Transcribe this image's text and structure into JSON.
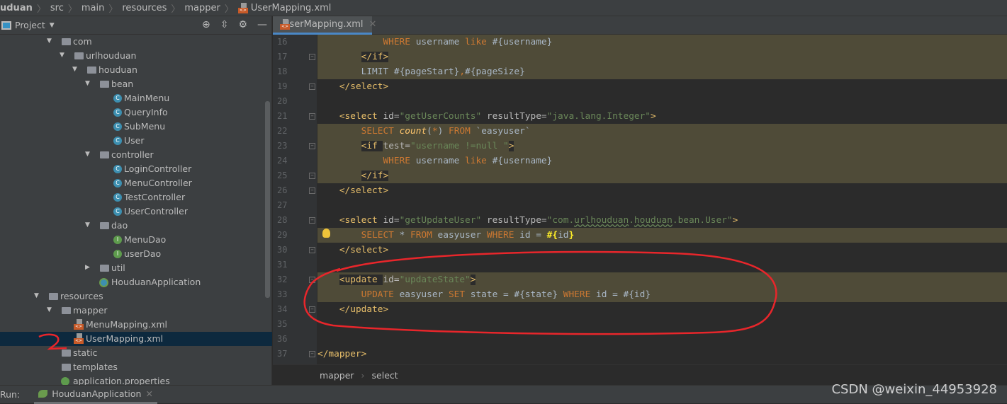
{
  "breadcrumb": [
    "uduan",
    "src",
    "main",
    "resources",
    "mapper",
    "UserMapping.xml"
  ],
  "project": {
    "title": "Project",
    "tools": [
      "locate-icon",
      "collapse-icon",
      "gear-icon",
      "minimize-icon"
    ],
    "tree": [
      {
        "label": "com",
        "depth": 1,
        "kind": "folder",
        "open": true
      },
      {
        "label": "urlhouduan",
        "depth": 2,
        "kind": "folder",
        "open": true
      },
      {
        "label": "houduan",
        "depth": 3,
        "kind": "folder",
        "open": true
      },
      {
        "label": "bean",
        "depth": 4,
        "kind": "folder",
        "open": true
      },
      {
        "label": "MainMenu",
        "depth": 5,
        "kind": "class"
      },
      {
        "label": "QueryInfo",
        "depth": 5,
        "kind": "class"
      },
      {
        "label": "SubMenu",
        "depth": 5,
        "kind": "class"
      },
      {
        "label": "User",
        "depth": 5,
        "kind": "class"
      },
      {
        "label": "controller",
        "depth": 4,
        "kind": "folder",
        "open": true
      },
      {
        "label": "LoginController",
        "depth": 5,
        "kind": "class"
      },
      {
        "label": "MenuController",
        "depth": 5,
        "kind": "class"
      },
      {
        "label": "TestController",
        "depth": 5,
        "kind": "class"
      },
      {
        "label": "UserController",
        "depth": 5,
        "kind": "class"
      },
      {
        "label": "dao",
        "depth": 4,
        "kind": "folder",
        "open": true
      },
      {
        "label": "MenuDao",
        "depth": 5,
        "kind": "interface"
      },
      {
        "label": "userDao",
        "depth": 5,
        "kind": "interface"
      },
      {
        "label": "util",
        "depth": 4,
        "kind": "folder",
        "open": false
      },
      {
        "label": "HouduanApplication",
        "depth": 4,
        "kind": "app"
      },
      {
        "label": "resources",
        "depth": 0,
        "kind": "folder",
        "open": true
      },
      {
        "label": "mapper",
        "depth": 1,
        "kind": "folder",
        "open": true
      },
      {
        "label": "MenuMapping.xml",
        "depth": 2,
        "kind": "xml"
      },
      {
        "label": "UserMapping.xml",
        "depth": 2,
        "kind": "xml",
        "selected": true
      },
      {
        "label": "static",
        "depth": 1,
        "kind": "leaf-folder"
      },
      {
        "label": "templates",
        "depth": 1,
        "kind": "leaf-folder"
      },
      {
        "label": "application.properties",
        "depth": 1,
        "kind": "props"
      }
    ]
  },
  "editor": {
    "tab": "UserMapping.xml",
    "lines": [
      {
        "n": "16",
        "hl": true,
        "t": [
          [
            "pl",
            "        "
          ],
          [
            "kw",
            "WHERE"
          ],
          [
            "pl",
            " username "
          ],
          [
            "kw",
            "like"
          ],
          [
            "pl",
            " #{username}"
          ]
        ]
      },
      {
        "n": "17",
        "hl": true,
        "f": true,
        "t": [
          [
            "pl",
            "    "
          ],
          [
            "tag",
            "</if>"
          ]
        ]
      },
      {
        "n": "18",
        "hl": true,
        "t": [
          [
            "pl",
            "    LIMIT #{pageStart}"
          ],
          [
            "kw",
            ","
          ],
          [
            "pl",
            "#{pageSize}"
          ]
        ]
      },
      {
        "n": "19",
        "f": true,
        "t": [
          [
            "tag",
            "</select>"
          ]
        ]
      },
      {
        "n": "20",
        "t": []
      },
      {
        "n": "21",
        "f": true,
        "t": [
          [
            "tag",
            "<select "
          ],
          [
            "attr",
            "id="
          ],
          [
            "str",
            "\"getUserCounts\""
          ],
          [
            "attr",
            " resultType="
          ],
          [
            "str",
            "\"java.lang.Integer\""
          ],
          [
            "tag",
            ">"
          ]
        ]
      },
      {
        "n": "22",
        "hl": true,
        "t": [
          [
            "pl",
            "    "
          ],
          [
            "kw",
            "SELECT "
          ],
          [
            "fn",
            "count"
          ],
          [
            "pl",
            "("
          ],
          [
            "kw",
            "*"
          ],
          [
            "pl",
            ") "
          ],
          [
            "kw",
            "FROM"
          ],
          [
            "pl",
            " `easyuser`"
          ]
        ]
      },
      {
        "n": "23",
        "hl": true,
        "f": true,
        "t": [
          [
            "pl",
            "    "
          ],
          [
            "tag",
            "<if "
          ],
          [
            "attr",
            "test="
          ],
          [
            "str",
            "\"username !=null \""
          ],
          [
            "tag",
            ">"
          ]
        ]
      },
      {
        "n": "24",
        "hl": true,
        "t": [
          [
            "pl",
            "        "
          ],
          [
            "kw",
            "WHERE"
          ],
          [
            "pl",
            " username "
          ],
          [
            "kw",
            "like"
          ],
          [
            "pl",
            " #{username}"
          ]
        ]
      },
      {
        "n": "25",
        "hl": true,
        "f": true,
        "t": [
          [
            "pl",
            "    "
          ],
          [
            "tag",
            "</if>"
          ]
        ]
      },
      {
        "n": "26",
        "f": true,
        "t": [
          [
            "tag",
            "</select>"
          ]
        ]
      },
      {
        "n": "27",
        "t": []
      },
      {
        "n": "28",
        "f": true,
        "t": [
          [
            "tag",
            "<select "
          ],
          [
            "attr",
            "id="
          ],
          [
            "str",
            "\"getUpdateUser\""
          ],
          [
            "attr",
            " resultType="
          ],
          [
            "str",
            "\"com."
          ],
          [
            "ul",
            "urlhouduan"
          ],
          [
            "str",
            "."
          ],
          [
            "ul",
            "houduan"
          ],
          [
            "str",
            ".bean.User\""
          ],
          [
            "tag",
            ">"
          ]
        ]
      },
      {
        "n": "29",
        "hl": true,
        "t": [
          [
            "pl",
            "    "
          ],
          [
            "kw",
            "SELECT "
          ],
          [
            "pl",
            "* "
          ],
          [
            "kw",
            "FROM"
          ],
          [
            "pl",
            " easyuser "
          ],
          [
            "kw",
            "WHERE"
          ],
          [
            "pl",
            " id = "
          ],
          [
            "bold",
            "#{"
          ],
          [
            "pl",
            "id"
          ],
          [
            "bold",
            "}"
          ]
        ]
      },
      {
        "n": "30",
        "f": true,
        "t": [
          [
            "tag",
            "</select>"
          ]
        ]
      },
      {
        "n": "31",
        "t": []
      },
      {
        "n": "32",
        "hl": true,
        "f": true,
        "t": [
          [
            "tag",
            "<update "
          ],
          [
            "attr",
            "id="
          ],
          [
            "str",
            "\"updateState\""
          ],
          [
            "tag",
            ">"
          ]
        ]
      },
      {
        "n": "33",
        "hl": true,
        "t": [
          [
            "pl",
            "    "
          ],
          [
            "kw",
            "UPDATE"
          ],
          [
            "pl",
            " easyuser "
          ],
          [
            "kw",
            "SET"
          ],
          [
            "pl",
            " state = #{state} "
          ],
          [
            "kw",
            "WHERE"
          ],
          [
            "pl",
            " id = #{id}"
          ]
        ]
      },
      {
        "n": "34",
        "f": true,
        "t": [
          [
            "tag",
            "</update>"
          ]
        ]
      },
      {
        "n": "35",
        "t": []
      },
      {
        "n": "36",
        "t": []
      },
      {
        "n": "37",
        "f": true,
        "root": true,
        "t": [
          [
            "tag",
            "</mapper>"
          ]
        ]
      }
    ],
    "breadcrumb": [
      "mapper",
      "select"
    ]
  },
  "run": {
    "label": "Run:",
    "config": "HouduanApplication"
  },
  "watermark": "CSDN @weixin_44953928",
  "colors": {
    "annotation": "#e8262b",
    "accent": "#4a88c7",
    "selection": "#0d293e"
  }
}
